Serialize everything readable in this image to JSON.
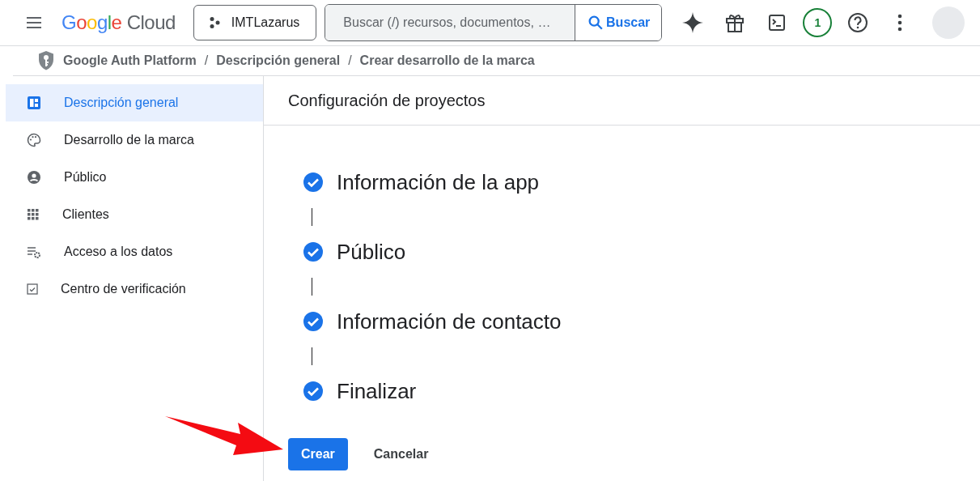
{
  "header": {
    "logo_brand": "Google",
    "logo_product": "Cloud",
    "project": "IMTLazarus",
    "search": {
      "placeholder": "Buscar (/) recursos, documentos, …",
      "button": "Buscar"
    },
    "notifications": "1"
  },
  "breadcrumb": {
    "separator": "/",
    "items": [
      "Google Auth Platform",
      "Descripción general",
      "Crear desarrollo de la marca"
    ]
  },
  "sidebar": {
    "items": [
      {
        "label": "Descripción general",
        "selected": true
      },
      {
        "label": "Desarrollo de la marca",
        "selected": false
      },
      {
        "label": "Público",
        "selected": false
      },
      {
        "label": "Clientes",
        "selected": false
      },
      {
        "label": "Acceso a los datos",
        "selected": false
      },
      {
        "label": "Centro de verificación",
        "selected": false
      }
    ]
  },
  "main": {
    "title": "Configuración de proyectos",
    "steps": [
      {
        "label": "Información de la app",
        "done": true
      },
      {
        "label": "Público",
        "done": true
      },
      {
        "label": "Información de contacto",
        "done": true
      },
      {
        "label": "Finalizar",
        "done": true
      }
    ],
    "buttons": [
      {
        "label": "Crear",
        "kind": "primary"
      },
      {
        "label": "Cancelar",
        "kind": "text"
      }
    ]
  }
}
